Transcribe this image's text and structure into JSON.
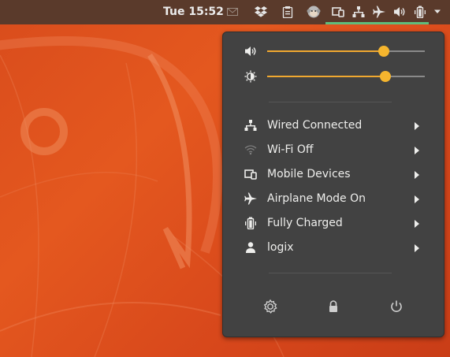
{
  "topbar": {
    "clock": "Tue 15:52",
    "indicators": [
      "mail-icon",
      "dropbox-icon",
      "clipboard-icon",
      "monkey-icon",
      "mobile-devices-icon",
      "network-wired-icon",
      "airplane-icon",
      "volume-icon",
      "battery-icon",
      "chevron-down-icon"
    ]
  },
  "menu": {
    "volume": {
      "icon": "volume-icon",
      "level": 0.74
    },
    "brightness": {
      "icon": "brightness-icon",
      "level": 0.75
    },
    "items": [
      {
        "icon": "network-wired-icon",
        "label": "Wired Connected"
      },
      {
        "icon": "wifi-icon",
        "label": "Wi-Fi Off"
      },
      {
        "icon": "mobile-devices-icon",
        "label": "Mobile Devices"
      },
      {
        "icon": "airplane-icon",
        "label": "Airplane Mode On"
      },
      {
        "icon": "battery-icon",
        "label": "Fully Charged"
      },
      {
        "icon": "user-icon",
        "label": "logix"
      }
    ],
    "system_buttons": [
      "settings-icon",
      "lock-icon",
      "power-icon"
    ]
  },
  "colors": {
    "topbar": "#5a3a2b",
    "menu_bg": "#424242",
    "slider_accent": "#f5b52e",
    "active_indicator": "#5fbd7c",
    "wallpaper": "#e4581f"
  }
}
